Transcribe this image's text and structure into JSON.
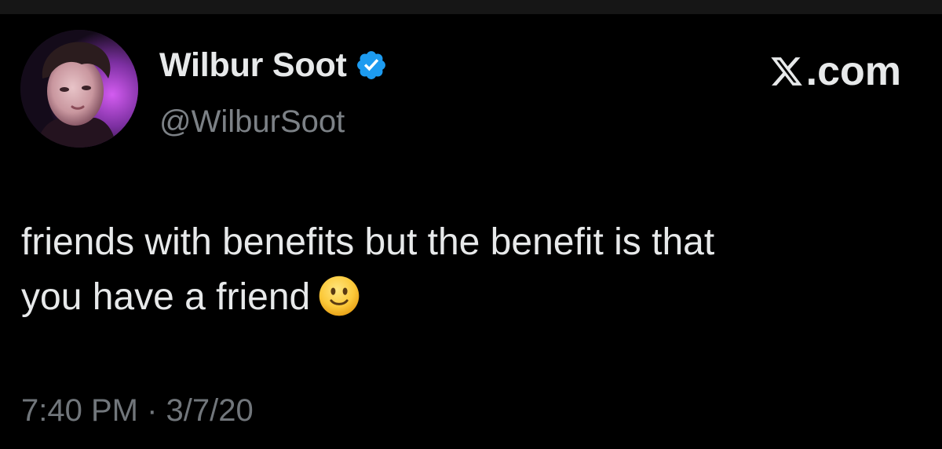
{
  "author": {
    "name": "Wilbur Soot",
    "handle": "@WilburSoot",
    "verified": true,
    "verified_color": "#1d9bf0"
  },
  "brand": {
    "label": ".com",
    "logo_icon": "x-logo-icon"
  },
  "tweet": {
    "text_lines": [
      "friends with benefits but the benefit is that",
      "you have a friend"
    ],
    "emoji": "slightly-smiling-face-emoji"
  },
  "timestamp": {
    "time": "7:40 PM",
    "separator": "·",
    "date": "3/7/20"
  },
  "colors": {
    "background": "#000000",
    "primary_text": "#e7e9ea",
    "secondary_text": "#71767b"
  }
}
